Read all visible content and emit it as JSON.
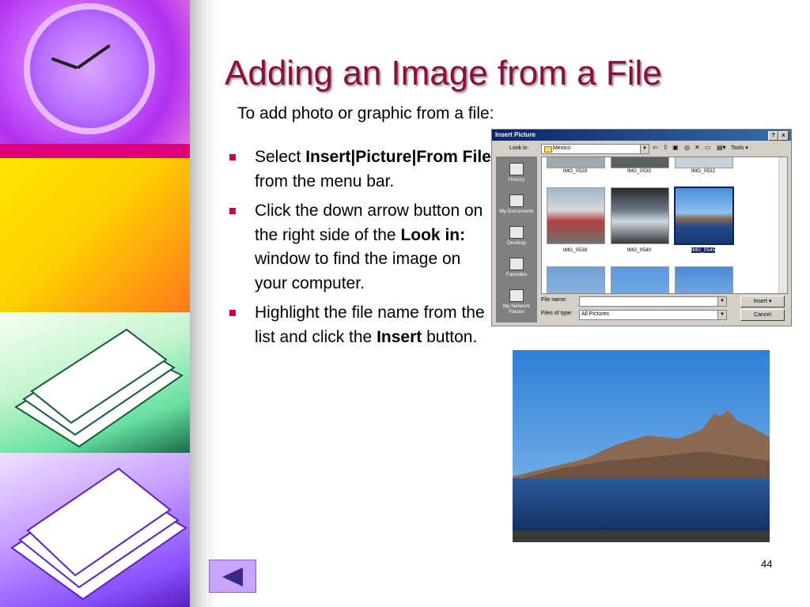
{
  "slide": {
    "title": "Adding an Image from a File",
    "subtitle": "To add photo or graphic from a file:",
    "page_number": "44",
    "bullets": [
      {
        "segments": [
          {
            "text": "Select ",
            "bold": false
          },
          {
            "text": "Insert|Picture|From File",
            "bold": true
          },
          {
            "text": " from the menu bar.",
            "bold": false
          }
        ]
      },
      {
        "segments": [
          {
            "text": "Click the down arrow button on the right side of the ",
            "bold": false
          },
          {
            "text": "Look in:",
            "bold": true
          },
          {
            "text": " window to find the image on your computer.",
            "bold": false
          }
        ]
      },
      {
        "segments": [
          {
            "text": "Highlight the file name from the list and click the ",
            "bold": false
          },
          {
            "text": "Insert",
            "bold": true
          },
          {
            "text": " button.",
            "bold": false
          }
        ]
      }
    ]
  },
  "dialog": {
    "title": "Insert Picture",
    "help_btn": "?",
    "close_btn": "x",
    "look_in_label": "Look in:",
    "look_in_value": "Mexico",
    "tools_label": "Tools",
    "places": [
      "History",
      "My Documents",
      "Desktop",
      "Favorites",
      "My Network Places"
    ],
    "files": [
      "IMG_0529",
      "IMG_0530",
      "IMG_0532",
      "IMG_0538",
      "IMG_0540",
      "IMG_0545"
    ],
    "selected_file": "IMG_0545",
    "file_name_label": "File name:",
    "file_name_value": "",
    "files_of_type_label": "Files of type:",
    "files_of_type_value": "All Pictures",
    "insert_button": "Insert",
    "cancel_button": "Cancel"
  },
  "colors": {
    "title": "#8a0f3e",
    "bullet": "#c8004e",
    "dialog_titlebar": "#0a246a",
    "nav_button": "#c9a4ff"
  },
  "icons": {
    "nav_back": "left-triangle-icon"
  }
}
